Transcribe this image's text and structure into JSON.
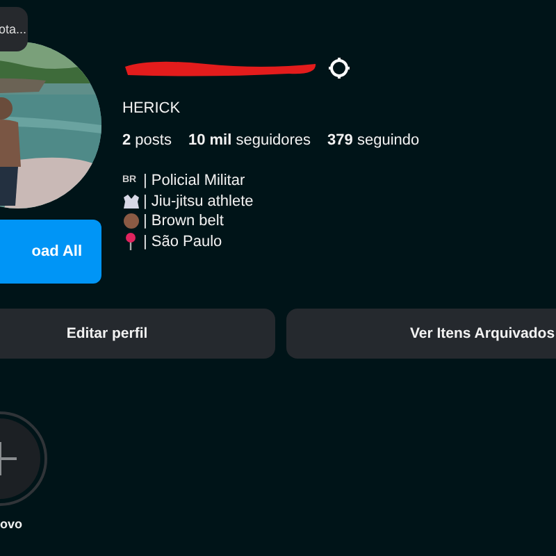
{
  "note": {
    "text": "ota..."
  },
  "profile": {
    "username_redacted": true,
    "name": "HERICK",
    "stats": [
      {
        "count": "2",
        "label": "posts"
      },
      {
        "count": "10 mil",
        "label": "seguidores"
      },
      {
        "count": "379",
        "label": "seguindo"
      }
    ],
    "bio": [
      {
        "kind": "letters",
        "mark": "BR",
        "text": "| Policial Militar"
      },
      {
        "kind": "gi",
        "text": "| Jiu-jitsu athlete"
      },
      {
        "kind": "dot",
        "text": "| Brown belt"
      },
      {
        "kind": "pin",
        "text": "| São Paulo"
      }
    ]
  },
  "load_button": "oad All",
  "actions": [
    "Editar perfil",
    "Ver Itens Arquivados"
  ],
  "highlights": [
    {
      "label": "ovo"
    }
  ]
}
